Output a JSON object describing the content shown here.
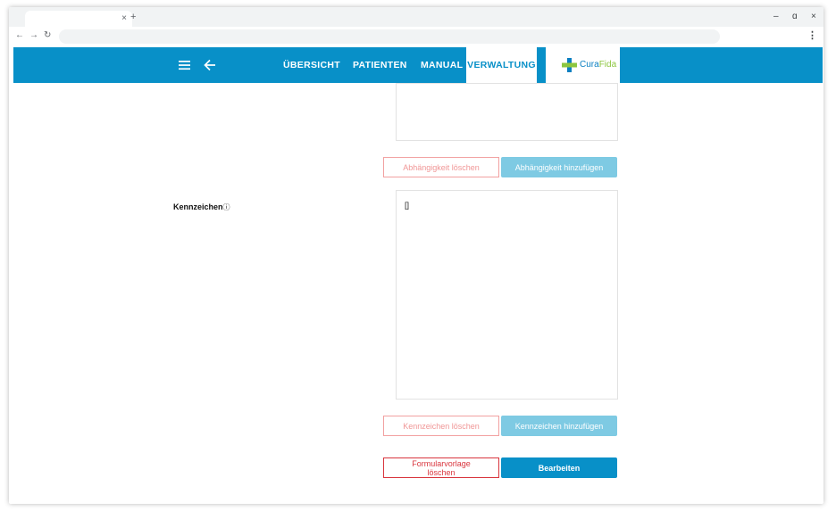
{
  "browser": {
    "tab_close": "×",
    "tab_new": "+",
    "win_minimize": "–",
    "win_restore": "ɑ",
    "win_close": "×",
    "nav_back": "←",
    "nav_forward": "→",
    "nav_reload": "↻",
    "menu": "⋮"
  },
  "appbar": {
    "nav": [
      "ÜBERSICHT",
      "PATIENTEN",
      "MANUAL",
      "VERWALTUNG"
    ],
    "active_nav": "VERWALTUNG",
    "logo_part1": "Cura",
    "logo_part2": "Fida",
    "brand_color": "#0890c8"
  },
  "dependency": {
    "delete_label": "Abhängigkeit löschen",
    "add_label": "Abhängigkeit hinzufügen"
  },
  "kennzeichen": {
    "label": "Kennzeichen",
    "info_icon": "ⓘ",
    "value": "[]",
    "delete_label": "Kennzeichen löschen",
    "add_label": "Kennzeichen hinzufügen"
  },
  "form": {
    "delete_template_label": "Formularvorlage löschen",
    "edit_label": "Bearbeiten"
  }
}
